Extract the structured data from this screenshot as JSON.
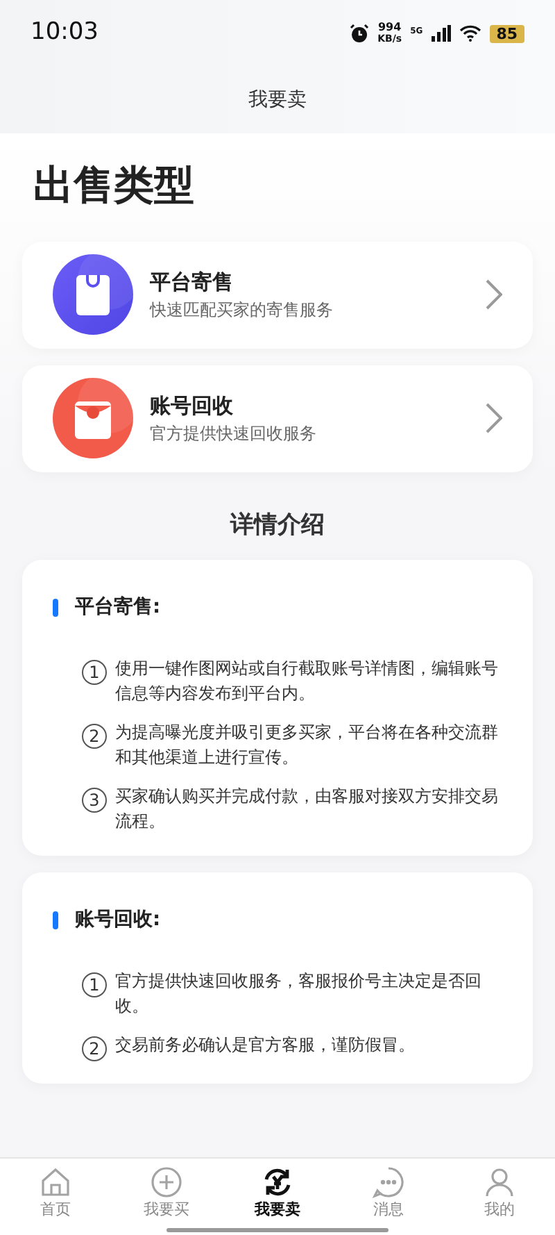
{
  "status_bar": {
    "time": "10:03",
    "speed": "994",
    "speed_unit": "KB/s",
    "network": "5G",
    "battery": "85"
  },
  "header": {
    "title": "我要卖"
  },
  "page_title": "出售类型",
  "sale_types": [
    {
      "kind": "consign",
      "title": "平台寄售",
      "subtitle": "快速匹配买家的寄售服务"
    },
    {
      "kind": "recycle",
      "title": "账号回收",
      "subtitle": "官方提供快速回收服务"
    }
  ],
  "details_heading": "详情介绍",
  "details": [
    {
      "title": "平台寄售:",
      "steps": [
        {
          "marker": "1",
          "text": "使用一键作图网站或自行截取账号详情图，编辑账号信息等内容发布到平台内。"
        },
        {
          "marker": "2",
          "text": "为提高曝光度并吸引更多买家，平台将在各种交流群和其他渠道上进行宣传。"
        },
        {
          "marker": "3",
          "text": "买家确认购买并完成付款，由客服对接双方安排交易流程。"
        }
      ]
    },
    {
      "title": "账号回收:",
      "steps": [
        {
          "marker": "1",
          "text": "官方提供快速回收服务，客服报价号主决定是否回收。"
        },
        {
          "marker": "2",
          "text": "交易前务必确认是官方客服，谨防假冒。"
        }
      ]
    }
  ],
  "tab_bar": [
    {
      "kind": "home",
      "label": "首页",
      "selected": false
    },
    {
      "kind": "buy",
      "label": "我要买",
      "selected": false
    },
    {
      "kind": "sell",
      "label": "我要卖",
      "selected": true
    },
    {
      "kind": "message",
      "label": "消息",
      "selected": false
    },
    {
      "kind": "profile",
      "label": "我的",
      "selected": false
    }
  ]
}
